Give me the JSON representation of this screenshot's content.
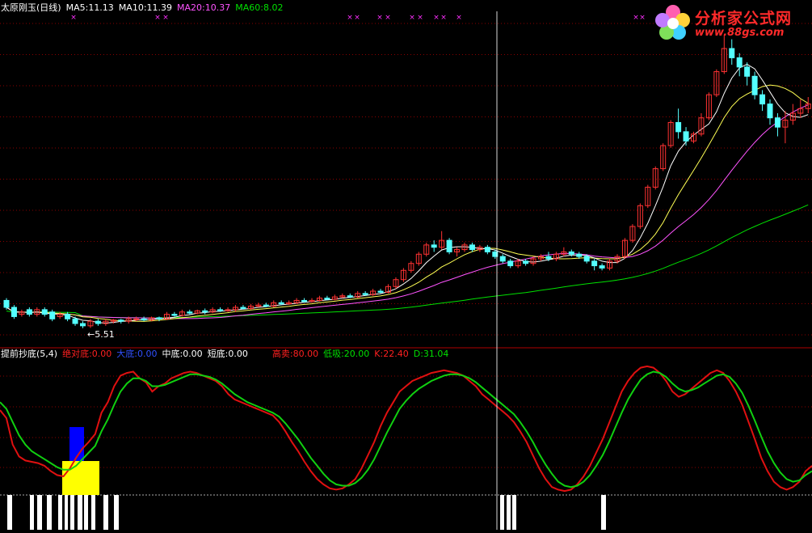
{
  "main_header": {
    "title": "太原刚玉(日线)",
    "ma5": "MA5:11.13",
    "ma10": "MA10:11.39",
    "ma20": "MA20:10.37",
    "ma60": "MA60:8.02"
  },
  "indicator_header": {
    "name": "提前抄底(5,4)",
    "jue_dui_di": "绝对底:0.00",
    "da_di": "大底:0.00",
    "zhong_di": "中底:0.00",
    "duan_di": "短底:0.00",
    "gao_mai": "高卖:80.00",
    "di_xi": "低吸:20.00",
    "k": "K:22.40",
    "d": "D:31.04"
  },
  "low_annotation": "←5.51",
  "logo": {
    "text": "分析家公式网",
    "url": "www.88gs.com",
    "icon": "flower-logo-icon"
  },
  "colors": {
    "up": "#ff3232",
    "down": "#54ffff",
    "ma5": "#ffffff",
    "ma10": "#ffff54",
    "ma20": "#ff54ff",
    "ma60": "#00e000",
    "k": "#e01010",
    "d": "#10d010",
    "signal": "#ff30ff",
    "bar_yellow": "#ffff00",
    "bar_blue": "#0000ff"
  },
  "chart_data": [
    {
      "type": "candlestick",
      "title": "太原刚玉(日线)",
      "series": [
        {
          "name": "MA5",
          "last": 11.13
        },
        {
          "name": "MA10",
          "last": 11.39
        },
        {
          "name": "MA20",
          "last": 10.37
        },
        {
          "name": "MA60",
          "last": 8.02
        }
      ],
      "min_price_label": 5.51,
      "candles": [
        [
          0,
          6.7,
          6.4,
          6.8,
          6.3
        ],
        [
          1,
          6.4,
          6.0,
          6.5,
          5.9
        ],
        [
          2,
          6.1,
          6.2,
          6.3,
          6.0
        ],
        [
          3,
          6.3,
          6.1,
          6.4,
          6.0
        ],
        [
          4,
          6.1,
          6.3,
          6.4,
          6.0
        ],
        [
          5,
          6.3,
          6.1,
          6.4,
          6.0
        ],
        [
          6,
          6.2,
          5.9,
          6.3,
          5.8
        ],
        [
          7,
          6.0,
          6.1,
          6.2,
          5.9
        ],
        [
          8,
          6.1,
          5.9,
          6.2,
          5.8
        ],
        [
          9,
          5.9,
          5.7,
          6.0,
          5.6
        ],
        [
          10,
          5.7,
          5.6,
          5.8,
          5.5
        ],
        [
          11,
          5.6,
          5.8,
          5.9,
          5.51
        ],
        [
          12,
          5.8,
          5.7,
          5.9,
          5.6
        ],
        [
          13,
          5.7,
          5.8,
          5.9,
          5.6
        ],
        [
          14,
          5.8,
          5.85,
          5.9,
          5.7
        ],
        [
          15,
          5.85,
          5.8,
          5.9,
          5.7
        ],
        [
          16,
          5.8,
          5.9,
          6.0,
          5.7
        ],
        [
          17,
          5.9,
          5.9,
          6.0,
          5.8
        ],
        [
          18,
          5.9,
          5.85,
          6.0,
          5.8
        ],
        [
          19,
          5.85,
          5.95,
          6.0,
          5.8
        ],
        [
          20,
          5.95,
          5.9,
          6.0,
          5.8
        ],
        [
          21,
          5.9,
          6.1,
          6.2,
          5.85
        ],
        [
          22,
          6.1,
          6.05,
          6.2,
          6.0
        ],
        [
          23,
          6.05,
          6.2,
          6.3,
          6.0
        ],
        [
          24,
          6.2,
          6.15,
          6.3,
          6.1
        ],
        [
          25,
          6.15,
          6.25,
          6.3,
          6.1
        ],
        [
          26,
          6.25,
          6.2,
          6.35,
          6.1
        ],
        [
          27,
          6.2,
          6.3,
          6.4,
          6.15
        ],
        [
          28,
          6.3,
          6.25,
          6.4,
          6.2
        ],
        [
          29,
          6.25,
          6.3,
          6.4,
          6.2
        ],
        [
          30,
          6.3,
          6.4,
          6.5,
          6.2
        ],
        [
          31,
          6.4,
          6.35,
          6.5,
          6.3
        ],
        [
          32,
          6.35,
          6.45,
          6.55,
          6.3
        ],
        [
          33,
          6.45,
          6.5,
          6.6,
          6.4
        ],
        [
          34,
          6.5,
          6.45,
          6.6,
          6.4
        ],
        [
          35,
          6.45,
          6.6,
          6.7,
          6.4
        ],
        [
          36,
          6.6,
          6.55,
          6.7,
          6.5
        ],
        [
          37,
          6.55,
          6.6,
          6.7,
          6.5
        ],
        [
          38,
          6.6,
          6.7,
          6.8,
          6.55
        ],
        [
          39,
          6.7,
          6.65,
          6.8,
          6.6
        ],
        [
          40,
          6.65,
          6.7,
          6.8,
          6.6
        ],
        [
          41,
          6.7,
          6.8,
          6.9,
          6.65
        ],
        [
          42,
          6.8,
          6.75,
          6.9,
          6.7
        ],
        [
          43,
          6.75,
          6.85,
          6.95,
          6.7
        ],
        [
          44,
          6.85,
          6.9,
          7.0,
          6.8
        ],
        [
          45,
          6.9,
          6.85,
          7.0,
          6.8
        ],
        [
          46,
          6.85,
          7.0,
          7.1,
          6.8
        ],
        [
          47,
          7.0,
          6.95,
          7.1,
          6.9
        ],
        [
          48,
          6.95,
          7.1,
          7.2,
          6.9
        ],
        [
          49,
          7.1,
          7.05,
          7.2,
          7.0
        ],
        [
          50,
          7.05,
          7.3,
          7.4,
          7.0
        ],
        [
          51,
          7.3,
          7.6,
          7.7,
          7.2
        ],
        [
          52,
          7.6,
          8.0,
          8.1,
          7.5
        ],
        [
          53,
          8.0,
          8.3,
          8.4,
          7.9
        ],
        [
          54,
          8.3,
          8.7,
          8.8,
          8.2
        ],
        [
          55,
          8.7,
          9.1,
          9.2,
          8.6
        ],
        [
          56,
          9.1,
          9.0,
          9.3,
          8.8
        ],
        [
          57,
          9.0,
          9.3,
          9.7,
          8.9
        ],
        [
          58,
          9.3,
          8.8,
          9.4,
          8.7
        ],
        [
          59,
          8.8,
          8.9,
          9.0,
          8.6
        ],
        [
          60,
          8.9,
          9.1,
          9.2,
          8.8
        ],
        [
          61,
          9.1,
          8.9,
          9.2,
          8.8
        ],
        [
          62,
          8.9,
          9.0,
          9.1,
          8.8
        ],
        [
          63,
          9.0,
          8.8,
          9.1,
          8.7
        ],
        [
          64,
          8.8,
          8.6,
          8.9,
          8.5
        ],
        [
          65,
          8.6,
          8.4,
          8.7,
          8.3
        ],
        [
          66,
          8.4,
          8.2,
          8.5,
          8.1
        ],
        [
          67,
          8.2,
          8.4,
          8.5,
          8.1
        ],
        [
          68,
          8.4,
          8.3,
          8.5,
          8.2
        ],
        [
          69,
          8.3,
          8.5,
          8.6,
          8.2
        ],
        [
          70,
          8.5,
          8.6,
          8.7,
          8.4
        ],
        [
          71,
          8.6,
          8.5,
          8.8,
          8.4
        ],
        [
          72,
          8.5,
          8.7,
          8.8,
          8.4
        ],
        [
          73,
          8.7,
          8.8,
          9.0,
          8.6
        ],
        [
          74,
          8.8,
          8.7,
          8.9,
          8.6
        ],
        [
          75,
          8.7,
          8.6,
          8.8,
          8.5
        ],
        [
          76,
          8.6,
          8.4,
          8.7,
          8.3
        ],
        [
          77,
          8.4,
          8.2,
          8.5,
          8.0
        ],
        [
          78,
          8.2,
          8.1,
          8.3,
          8.0
        ],
        [
          79,
          8.1,
          8.4,
          8.5,
          8.0
        ],
        [
          80,
          8.4,
          8.6,
          8.7,
          8.3
        ],
        [
          81,
          8.6,
          9.3,
          9.4,
          8.5
        ],
        [
          82,
          9.3,
          9.9,
          10.0,
          9.2
        ],
        [
          83,
          9.9,
          10.8,
          10.9,
          9.8
        ],
        [
          84,
          10.8,
          11.6,
          11.7,
          10.7
        ],
        [
          85,
          11.6,
          12.4,
          12.5,
          11.5
        ],
        [
          86,
          12.4,
          13.4,
          13.5,
          12.3
        ],
        [
          87,
          13.4,
          14.4,
          14.5,
          13.3
        ],
        [
          88,
          14.4,
          14.0,
          15.0,
          13.7
        ],
        [
          89,
          14.0,
          13.6,
          14.2,
          13.4
        ],
        [
          90,
          13.6,
          13.9,
          14.0,
          13.5
        ],
        [
          91,
          13.9,
          14.6,
          14.8,
          13.8
        ],
        [
          92,
          14.6,
          15.6,
          15.7,
          14.5
        ],
        [
          93,
          15.6,
          16.6,
          16.7,
          15.5
        ],
        [
          94,
          16.6,
          17.6,
          18.2,
          16.5
        ],
        [
          95,
          17.6,
          17.2,
          18.0,
          16.9
        ],
        [
          96,
          17.2,
          16.8,
          17.4,
          16.4
        ],
        [
          97,
          16.8,
          16.4,
          17.0,
          16.0
        ],
        [
          98,
          16.4,
          15.6,
          16.6,
          15.4
        ],
        [
          99,
          15.6,
          15.2,
          15.8,
          14.9
        ],
        [
          100,
          15.2,
          14.6,
          15.4,
          14.3
        ],
        [
          101,
          14.6,
          14.2,
          14.8,
          13.8
        ],
        [
          102,
          14.2,
          14.5,
          14.9,
          13.5
        ],
        [
          103,
          14.5,
          14.8,
          15.2,
          14.3
        ],
        [
          104,
          14.8,
          15.0,
          15.4,
          14.6
        ],
        [
          105,
          15.0,
          15.2,
          15.5,
          14.8
        ]
      ]
    },
    {
      "type": "line",
      "title": "提前抄底(5,4)",
      "series": [
        {
          "name": "K",
          "last": 22.4,
          "values": [
            64,
            58,
            38,
            29,
            26,
            25,
            24,
            22,
            18,
            15,
            14,
            20,
            28,
            35,
            40,
            46,
            62,
            70,
            82,
            90,
            92,
            93,
            88,
            85,
            78,
            82,
            84,
            88,
            90,
            92,
            93,
            92,
            90,
            88,
            86,
            82,
            76,
            72,
            70,
            68,
            66,
            64,
            62,
            60,
            55,
            48,
            40,
            33,
            25,
            18,
            12,
            8,
            5,
            4,
            5,
            8,
            12,
            20,
            30,
            40,
            52,
            62,
            70,
            78,
            82,
            86,
            88,
            90,
            92,
            93,
            94,
            93,
            92,
            90,
            86,
            82,
            76,
            72,
            68,
            64,
            60,
            55,
            48,
            40,
            30,
            20,
            12,
            6,
            4,
            3,
            4,
            8,
            14,
            22,
            32,
            42,
            54,
            66,
            78,
            86,
            92,
            96,
            97,
            96,
            92,
            86,
            78,
            74,
            76,
            80,
            84,
            88,
            92,
            94,
            92,
            86,
            78,
            68,
            55,
            42,
            28,
            18,
            10,
            6,
            4,
            6,
            10,
            18,
            22
          ]
        },
        {
          "name": "D",
          "last": 31.04,
          "values": [
            70,
            65,
            55,
            45,
            38,
            33,
            30,
            27,
            24,
            21,
            19,
            19,
            22,
            27,
            32,
            37,
            48,
            57,
            68,
            78,
            84,
            88,
            88,
            86,
            82,
            82,
            83,
            85,
            87,
            89,
            91,
            91,
            90,
            89,
            87,
            84,
            80,
            76,
            73,
            70,
            68,
            66,
            64,
            62,
            59,
            54,
            48,
            42,
            35,
            28,
            22,
            16,
            11,
            8,
            7,
            7,
            9,
            13,
            19,
            27,
            37,
            47,
            56,
            65,
            71,
            76,
            80,
            83,
            86,
            88,
            90,
            91,
            91,
            90,
            88,
            85,
            81,
            77,
            73,
            69,
            65,
            61,
            55,
            48,
            40,
            31,
            23,
            16,
            10,
            7,
            6,
            7,
            10,
            15,
            22,
            30,
            40,
            51,
            62,
            72,
            80,
            87,
            91,
            93,
            92,
            89,
            84,
            80,
            78,
            79,
            81,
            84,
            87,
            90,
            91,
            89,
            84,
            77,
            67,
            56,
            44,
            33,
            24,
            17,
            12,
            10,
            11,
            15,
            18
          ]
        }
      ],
      "reference_lines": {
        "gao_mai": 80.0,
        "di_xi": 20.0
      }
    }
  ]
}
